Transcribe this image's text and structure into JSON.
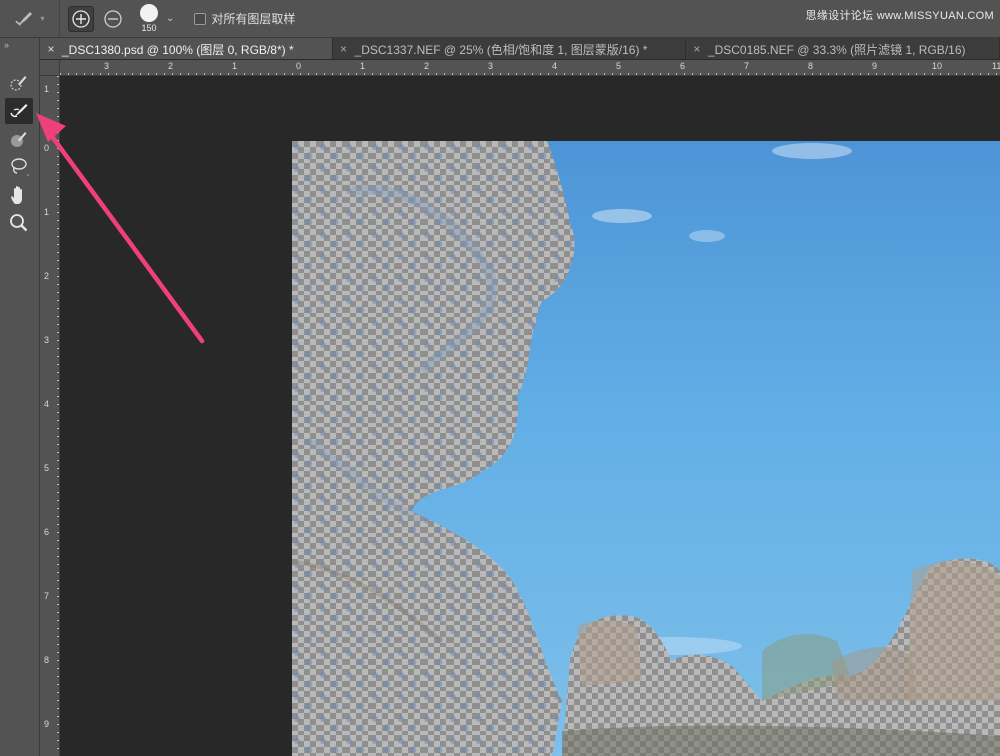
{
  "options_bar": {
    "tool_icon": "quick-selection-brush-icon",
    "mode_add_icon": "add-to-selection-icon",
    "mode_subtract_icon": "subtract-from-selection-icon",
    "brush_size": "150",
    "sample_all_layers_label": "对所有图层取样",
    "sample_all_layers_checked": false
  },
  "watermark": "思缘设计论坛 www.MISSYUAN.COM",
  "toolbar": {
    "collapse_label": "››",
    "tools": [
      {
        "name": "quick-selection-icon",
        "active": false
      },
      {
        "name": "refine-edge-brush-icon",
        "active": true
      },
      {
        "name": "brush-icon",
        "active": false
      },
      {
        "name": "lasso-icon",
        "active": false
      },
      {
        "name": "hand-icon",
        "active": false
      },
      {
        "name": "zoom-icon",
        "active": false
      }
    ]
  },
  "tabs": [
    {
      "title": "_DSC1380.psd @ 100% (图层 0, RGB/8*) *",
      "active": true
    },
    {
      "title": "_DSC1337.NEF @ 25% (色相/饱和度 1, 图层蒙版/16) *",
      "active": false
    },
    {
      "title": "_DSC0185.NEF @ 33.3% (照片滤镜 1, RGB/16)",
      "active": false
    }
  ],
  "ruler_top_labels": [
    "3",
    "2",
    "1",
    "0",
    "1",
    "2",
    "3",
    "4",
    "5",
    "6",
    "7",
    "8",
    "9",
    "10",
    "11"
  ],
  "ruler_left_labels": [
    "1",
    "0",
    "1",
    "2",
    "3",
    "4",
    "5",
    "6",
    "7",
    "8",
    "9"
  ],
  "colors": {
    "accent_arrow": "#f0407a",
    "panel": "#535353",
    "canvas_bg": "#282828",
    "sky": "#62aee6"
  }
}
